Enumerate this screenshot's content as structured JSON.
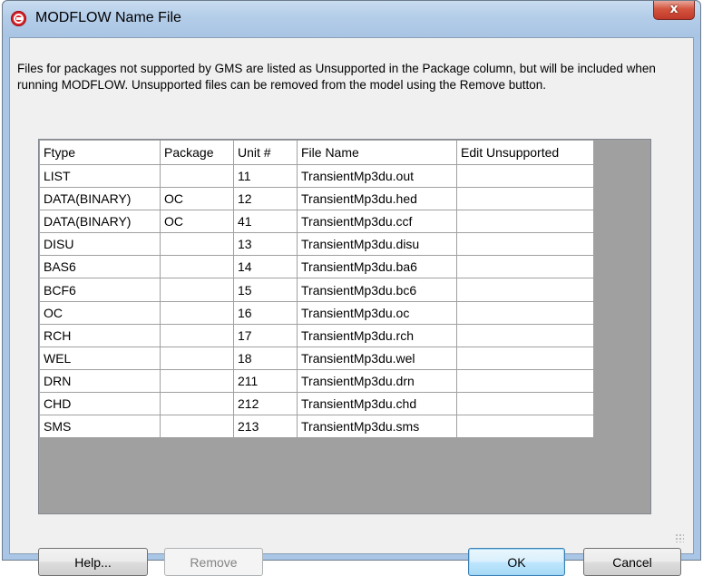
{
  "window": {
    "title": "MODFLOW Name File",
    "close_label": "x"
  },
  "description": "Files for packages not supported by GMS are listed as Unsupported in the Package column, but will be included when running MODFLOW.  Unsupported files can be removed from the model using the Remove button.",
  "table": {
    "headers": [
      "Ftype",
      "Package",
      "Unit #",
      "File Name",
      "Edit Unsupported"
    ],
    "rows": [
      [
        "LIST",
        "",
        "11",
        "TransientMp3du.out",
        ""
      ],
      [
        "DATA(BINARY)",
        "OC",
        "12",
        "TransientMp3du.hed",
        ""
      ],
      [
        "DATA(BINARY)",
        "OC",
        "41",
        "TransientMp3du.ccf",
        ""
      ],
      [
        "DISU",
        "",
        "13",
        "TransientMp3du.disu",
        ""
      ],
      [
        "BAS6",
        "",
        "14",
        "TransientMp3du.ba6",
        ""
      ],
      [
        "BCF6",
        "",
        "15",
        "TransientMp3du.bc6",
        ""
      ],
      [
        "OC",
        "",
        "16",
        "TransientMp3du.oc",
        ""
      ],
      [
        "RCH",
        "",
        "17",
        "TransientMp3du.rch",
        ""
      ],
      [
        "WEL",
        "",
        "18",
        "TransientMp3du.wel",
        ""
      ],
      [
        "DRN",
        "",
        "211",
        "TransientMp3du.drn",
        ""
      ],
      [
        "CHD",
        "",
        "212",
        "TransientMp3du.chd",
        ""
      ],
      [
        "SMS",
        "",
        "213",
        "TransientMp3du.sms",
        ""
      ]
    ]
  },
  "buttons": {
    "help": "Help...",
    "remove": "Remove",
    "ok": "OK",
    "cancel": "Cancel"
  },
  "colors": {
    "titlebar": "#b3cde9",
    "close": "#c0382a",
    "grid_bg": "#a0a0a0",
    "client": "#f0f0f0"
  }
}
